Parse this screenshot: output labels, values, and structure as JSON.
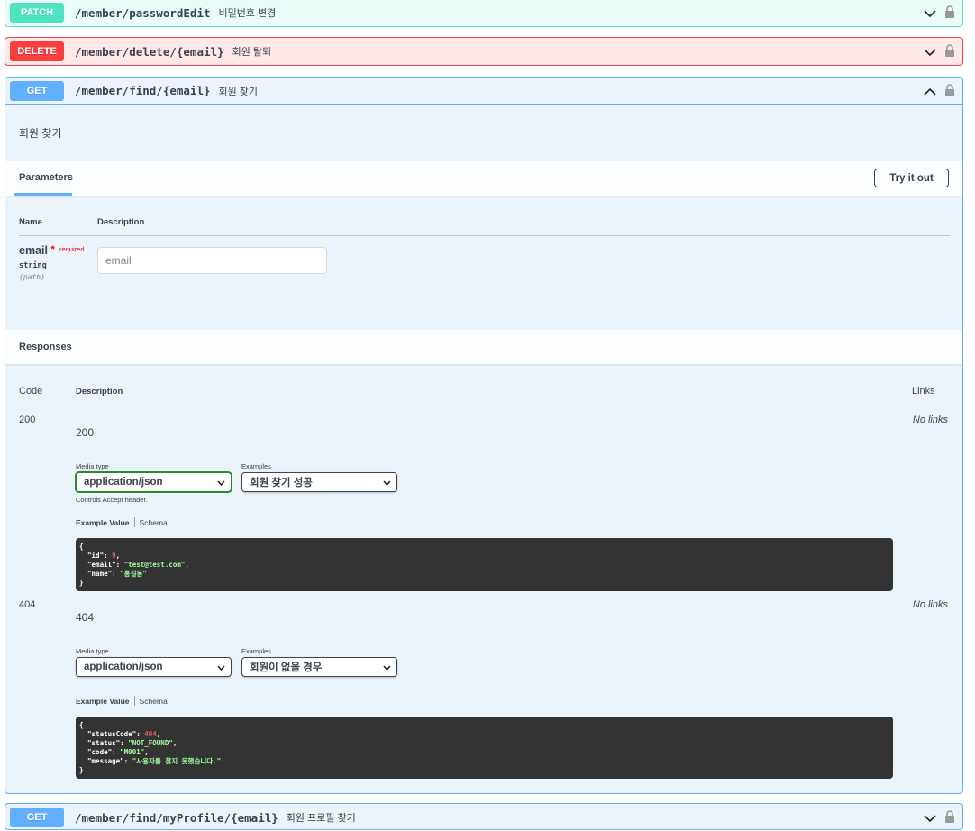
{
  "endpoints": [
    {
      "method": "PATCH",
      "path": "/member/passwordEdit",
      "summary": "비밀번호 변경"
    },
    {
      "method": "DELETE",
      "path": "/member/delete/{email}",
      "summary": "회원 탈퇴"
    },
    {
      "method": "GET",
      "path": "/member/find/{email}",
      "summary": "회원 찾기"
    },
    {
      "method": "GET",
      "path": "/member/find/myProfile/{email}",
      "summary": "회원 프로필 찾기"
    }
  ],
  "expanded": {
    "description": "회원 찾기",
    "parameters_tab": "Parameters",
    "try_it_out": "Try it out",
    "col_name": "Name",
    "col_description": "Description",
    "param": {
      "name": "email",
      "star": "*",
      "required": "required",
      "type": "string",
      "in": "(path)",
      "placeholder": "email",
      "value": ""
    },
    "responses_title": "Responses",
    "resp_col_code": "Code",
    "resp_col_description": "Description",
    "resp_col_links": "Links",
    "responses": [
      {
        "code": "200",
        "description": "200",
        "links": "No links",
        "media_type_label": "Media type",
        "media_type": "application/json",
        "examples_label": "Examples",
        "example_selected": "회원 찾기 성공",
        "controls_note": "Controls Accept header.",
        "example_value_tab": "Example Value",
        "schema_tab": "Schema",
        "example_json": {
          "id": "9",
          "email": "\"test@test.com\"",
          "name": "\"홍길동\""
        }
      },
      {
        "code": "404",
        "description": "404",
        "links": "No links",
        "media_type_label": "Media type",
        "media_type": "application/json",
        "examples_label": "Examples",
        "example_selected": "회원이 없을 경우",
        "example_value_tab": "Example Value",
        "schema_tab": "Schema",
        "example_json": {
          "statusCode": "404",
          "status": "\"NOT_FOUND\"",
          "code": "\"M001\"",
          "message": "\"사용자를 찾지 못했습니다.\""
        }
      }
    ]
  },
  "colors": {
    "patch": "#50e3c2",
    "delete": "#f93e3e",
    "get": "#61affe"
  },
  "icons": [
    "chevron-down-icon",
    "chevron-up-icon",
    "lock-icon"
  ]
}
